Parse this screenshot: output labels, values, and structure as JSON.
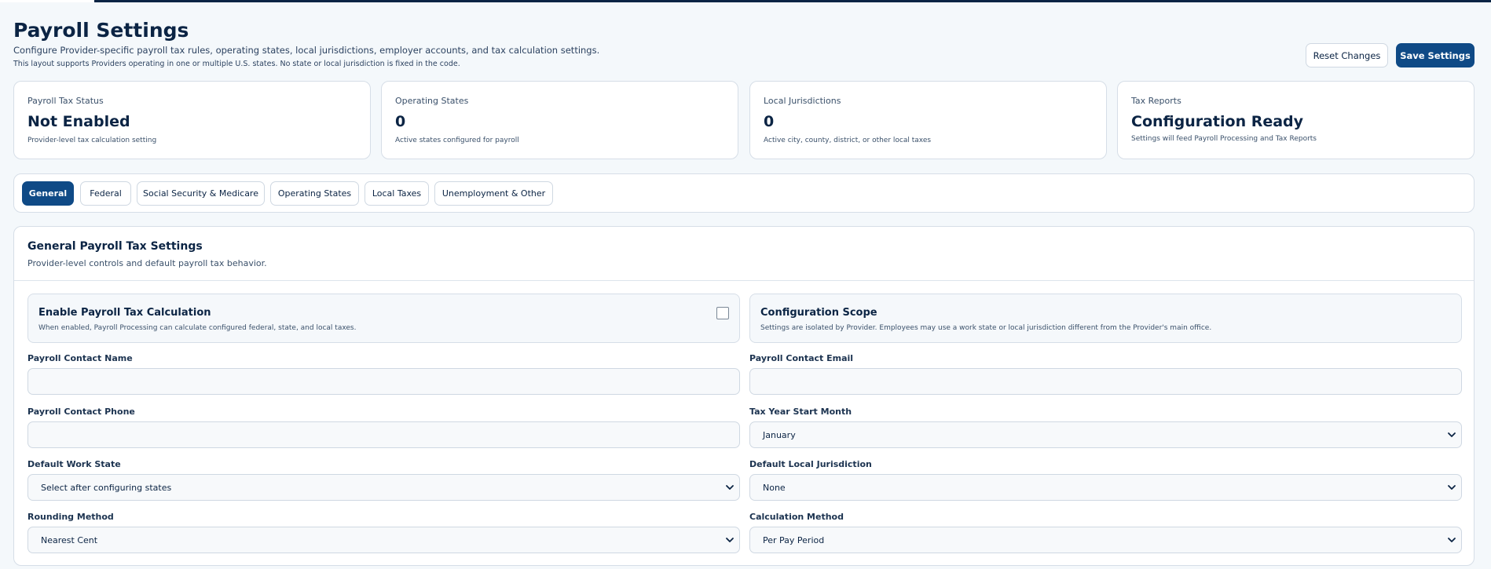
{
  "header": {
    "title": "Payroll Settings",
    "subtitle": "Configure Provider-specific payroll tax rules, operating states, local jurisdictions, employer accounts, and tax calculation settings.",
    "note": "This layout supports Providers operating in one or multiple U.S. states. No state or local jurisdiction is fixed in the code.",
    "reset_label": "Reset Changes",
    "save_label": "Save Settings"
  },
  "stats": [
    {
      "label": "Payroll Tax Status",
      "value": "Not Enabled",
      "desc": "Provider-level tax calculation setting"
    },
    {
      "label": "Operating States",
      "value": "0",
      "desc": "Active states configured for payroll"
    },
    {
      "label": "Local Jurisdictions",
      "value": "0",
      "desc": "Active city, county, district, or other local taxes"
    },
    {
      "label": "Tax Reports",
      "value": "Configuration Ready",
      "desc": "Settings will feed Payroll Processing and Tax Reports"
    }
  ],
  "tabs": [
    {
      "label": "General",
      "active": true
    },
    {
      "label": "Federal"
    },
    {
      "label": "Social Security & Medicare"
    },
    {
      "label": "Operating States"
    },
    {
      "label": "Local Taxes"
    },
    {
      "label": "Unemployment & Other"
    }
  ],
  "section": {
    "title": "General Payroll Tax Settings",
    "subtitle": "Provider-level controls and default payroll tax behavior."
  },
  "options": {
    "enable": {
      "title": "Enable Payroll Tax Calculation",
      "desc": "When enabled, Payroll Processing can calculate configured federal, state, and local taxes.",
      "checked": false
    },
    "scope": {
      "title": "Configuration Scope",
      "desc": "Settings are isolated by Provider. Employees may use a work state or local jurisdiction different from the Provider's main office."
    }
  },
  "fields": {
    "contact_name": {
      "label": "Payroll Contact Name",
      "value": ""
    },
    "contact_email": {
      "label": "Payroll Contact Email",
      "value": ""
    },
    "contact_phone": {
      "label": "Payroll Contact Phone",
      "value": ""
    },
    "tax_year_start": {
      "label": "Tax Year Start Month",
      "value": "January"
    },
    "default_work_state": {
      "label": "Default Work State",
      "value": "Select after configuring states"
    },
    "default_local": {
      "label": "Default Local Jurisdiction",
      "value": "None"
    },
    "rounding": {
      "label": "Rounding Method",
      "value": "Nearest Cent"
    },
    "calculation": {
      "label": "Calculation Method",
      "value": "Per Pay Period"
    }
  },
  "icons": {
    "chevron": "chevron-down-icon"
  },
  "colors": {
    "primary": "#0f4a86",
    "text": "#0b2444",
    "border": "#d6dee7",
    "background": "#f4f8fb"
  }
}
